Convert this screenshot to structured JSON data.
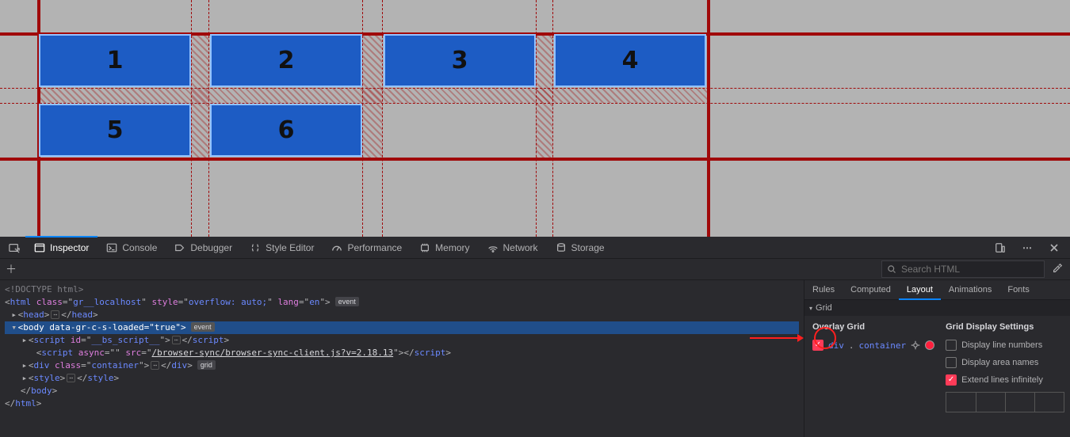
{
  "viewport": {
    "cells": [
      "1",
      "2",
      "3",
      "4",
      "5",
      "6"
    ]
  },
  "devtools": {
    "tabs": {
      "inspector": "Inspector",
      "console": "Console",
      "debugger": "Debugger",
      "style_editor": "Style Editor",
      "performance": "Performance",
      "memory": "Memory",
      "network": "Network",
      "storage": "Storage"
    },
    "search_placeholder": "Search HTML",
    "dom": {
      "doctype": "<!DOCTYPE html>",
      "html_open": "<html class=\"gr__localhost\" style=\"overflow: auto;\" lang=\"en\">",
      "head": "<head>…</head>",
      "body_open": "<body data-gr-c-s-loaded=\"true\">",
      "body_badge": "event",
      "script1": "<script id=\"__bs_script__\">…</​script>",
      "script2_pre": "<script async=\"\" src=\"",
      "script2_src": "/browser-sync/browser-sync-client.js?v=2.18.13",
      "script2_post": "\"></​script>",
      "div_container": "<div class=\"container\">…</div>",
      "grid_badge": "grid",
      "style": "<style>…</style>",
      "body_close": "</body>",
      "html_close": "</html>",
      "html_badge": "event"
    },
    "side_tabs": {
      "rules": "Rules",
      "computed": "Computed",
      "layout": "Layout",
      "animations": "Animations",
      "fonts": "Fonts"
    },
    "grid_panel": {
      "header": "Grid",
      "overlay_header": "Overlay Grid",
      "overlay_item": "div.container",
      "settings_header": "Grid Display Settings",
      "opt_line_numbers": "Display line numbers",
      "opt_area_names": "Display area names",
      "opt_extend": "Extend lines infinitely"
    }
  }
}
